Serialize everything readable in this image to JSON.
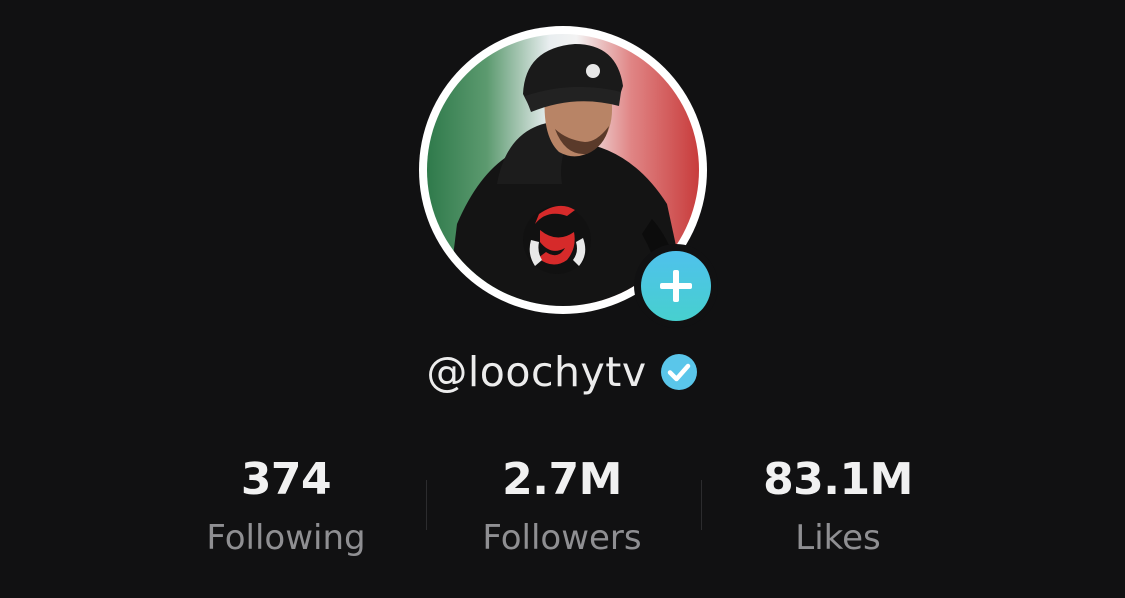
{
  "profile": {
    "username": "@loochytv",
    "verified": true
  },
  "icons": {
    "add": "plus-icon",
    "verified": "verified-check-icon"
  },
  "colors": {
    "background": "#111112",
    "accent": "#4fc1ec",
    "label": "#8f8f92"
  },
  "stats": [
    {
      "value": "374",
      "label": "Following"
    },
    {
      "value": "2.7M",
      "label": "Followers"
    },
    {
      "value": "83.1M",
      "label": "Likes"
    }
  ]
}
